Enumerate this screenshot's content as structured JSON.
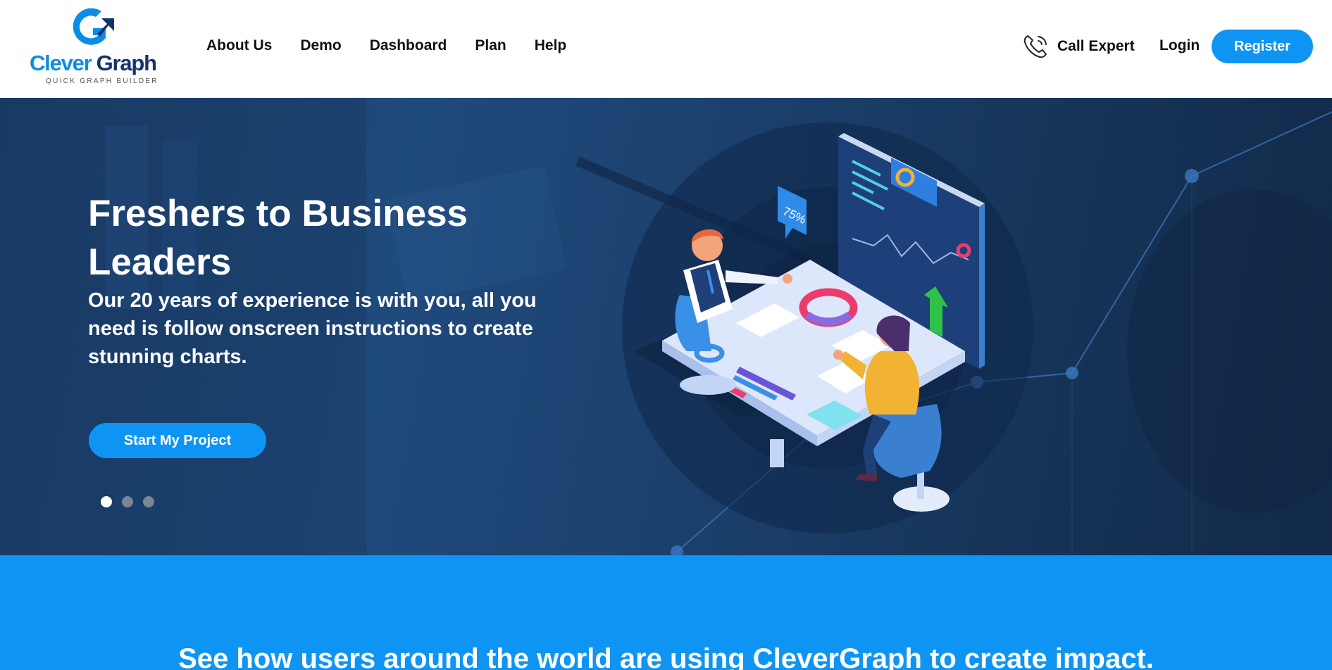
{
  "brand": {
    "name_part1": "Clever",
    "name_part2": "Graph",
    "tagline": "QUICK GRAPH BUILDER",
    "primary_color": "#0b8de6",
    "dark_color": "#15346f"
  },
  "nav": {
    "items": [
      {
        "label": "About Us"
      },
      {
        "label": "Demo"
      },
      {
        "label": "Dashboard"
      },
      {
        "label": "Plan"
      },
      {
        "label": "Help"
      }
    ]
  },
  "header_actions": {
    "call_label": "Call Expert",
    "call_icon": "phone-icon",
    "login_label": "Login",
    "register_label": "Register"
  },
  "hero": {
    "title": "Freshers to Business Leaders",
    "subtitle": "Our 20 years of experience is with you, all you need is follow onscreen instructions to create stunning charts.",
    "cta_label": "Start My Project",
    "slides": [
      {
        "active": true
      },
      {
        "active": false
      },
      {
        "active": false
      }
    ],
    "illustration_badge": "75%"
  },
  "impact": {
    "title": "See how users around the world are using CleverGraph to create impact."
  },
  "colors": {
    "accent": "#0e95f4",
    "hero_dark": "#1a3d6a"
  }
}
